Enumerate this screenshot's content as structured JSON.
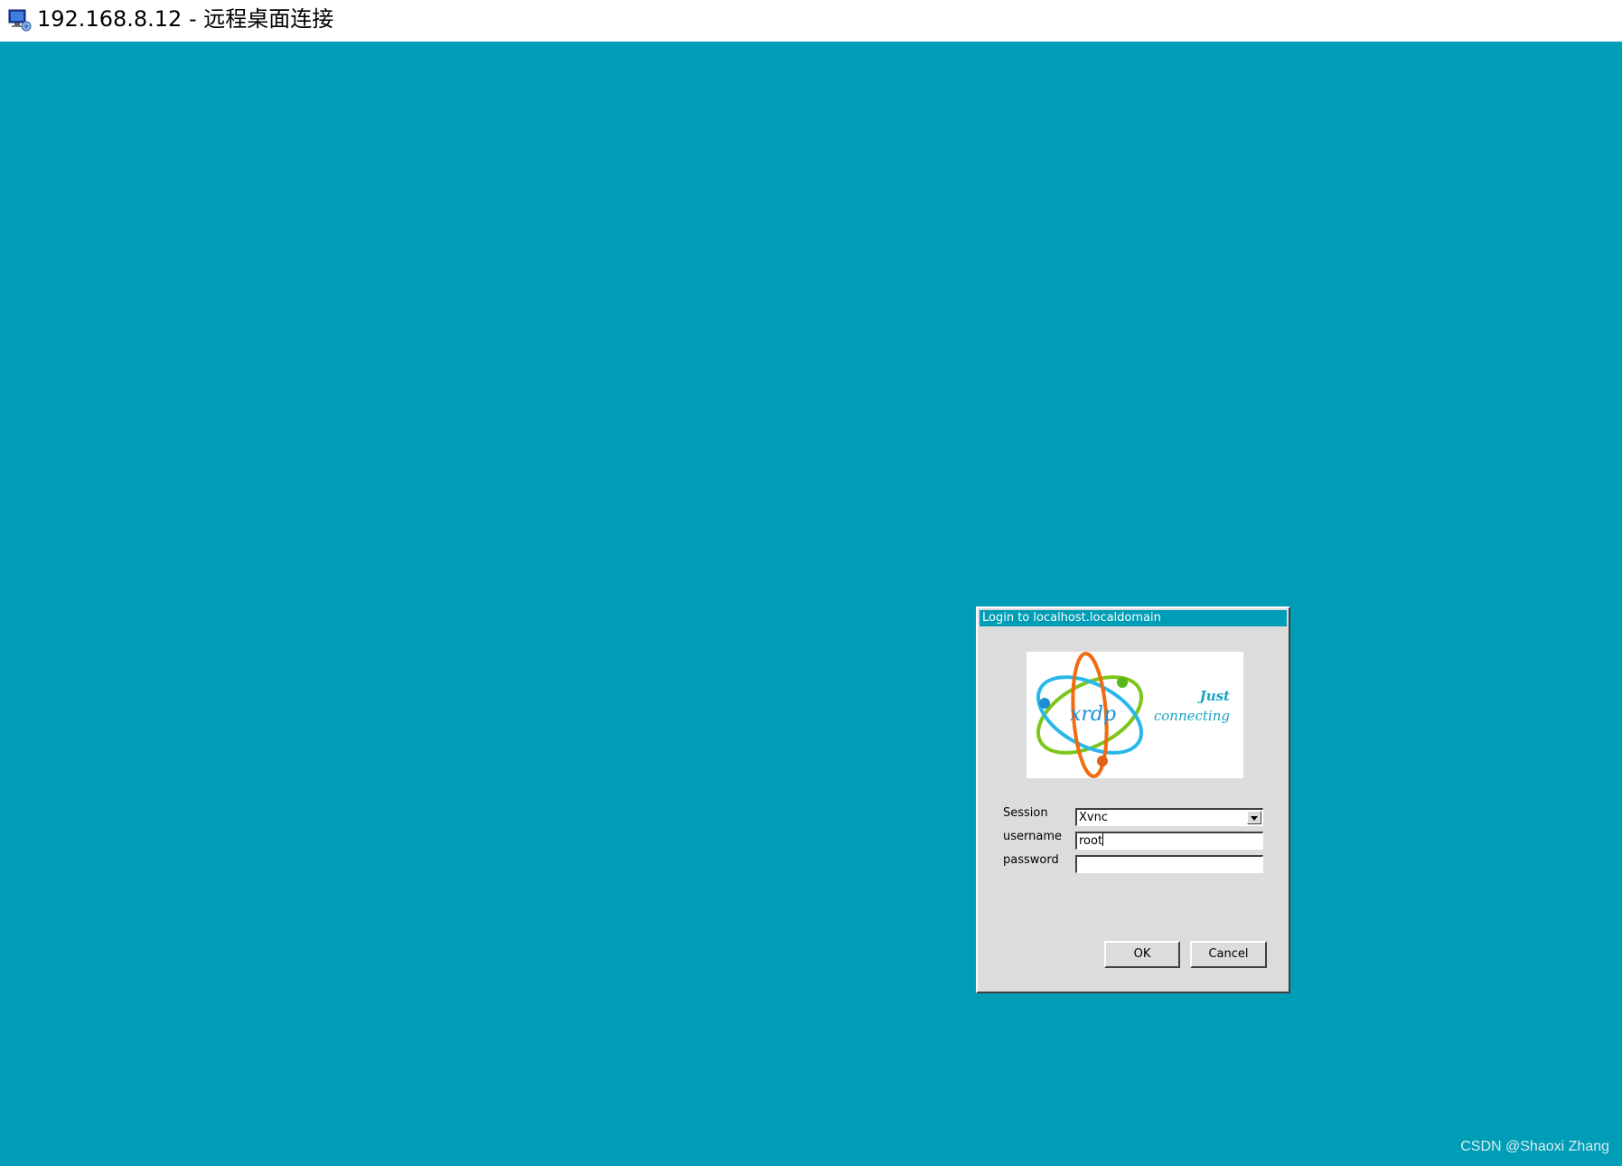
{
  "window": {
    "title": "192.168.8.12 - 远程桌面连接",
    "icon": "remote-desktop-icon",
    "desktop_color": "#009db6"
  },
  "login_dialog": {
    "title": "Login to localhost.localdomain",
    "logo": {
      "brand": "xrdp",
      "tagline_line1": "Just",
      "tagline_line2": "connecting"
    },
    "fields": {
      "session_label": "Session",
      "session_value": "Xvnc",
      "username_label": "username",
      "username_value": "root",
      "password_label": "password",
      "password_value": ""
    },
    "buttons": {
      "ok_label": "OK",
      "cancel_label": "Cancel"
    },
    "title_color": "#009db6"
  },
  "watermark": "CSDN @Shaoxi Zhang"
}
